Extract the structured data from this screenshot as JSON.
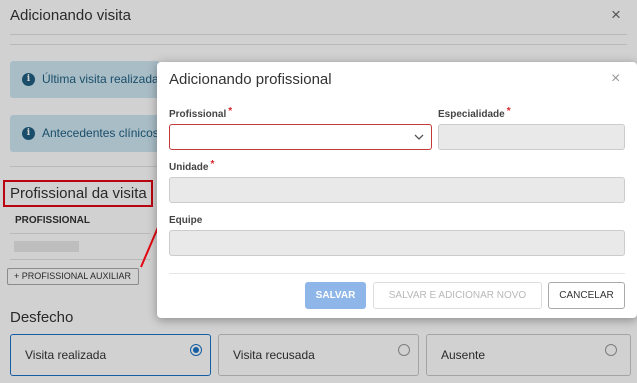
{
  "background_dialog": {
    "title": "Adicionando visita",
    "close_glyph": "×",
    "alert_last_visit": "Última visita realizada",
    "alert_history": "Antecedentes clínicos:",
    "section_title": "Profissional da visita",
    "table_header": "PROFISSIONAL",
    "add_aux_button": "+ PROFISSIONAL AUXILIAR",
    "outcome_title": "Desfecho",
    "outcomes": [
      {
        "label": "Visita realizada",
        "selected": true
      },
      {
        "label": "Visita recusada",
        "selected": false
      },
      {
        "label": "Ausente",
        "selected": false
      }
    ]
  },
  "modal": {
    "title": "Adicionando profissional",
    "close_glyph": "×",
    "fields": {
      "profissional": {
        "label": "Profissional",
        "required_mark": "*",
        "value": ""
      },
      "especialidade": {
        "label": "Especialidade",
        "required_mark": "*",
        "value": ""
      },
      "unidade": {
        "label": "Unidade",
        "required_mark": "*",
        "value": ""
      },
      "equipe": {
        "label": "Equipe",
        "value": ""
      }
    },
    "buttons": {
      "save": "SALVAR",
      "save_and_new": "SALVAR E ADICIONAR NOVO",
      "cancel": "CANCELAR"
    }
  },
  "colors": {
    "primary": "#1a73c9",
    "required": "#d9252b",
    "annotation_red": "#e30613",
    "info_bg": "#cfe7f3"
  },
  "icons": [
    "close-icon",
    "info-icon",
    "chevron-down-icon",
    "radio-icon"
  ]
}
